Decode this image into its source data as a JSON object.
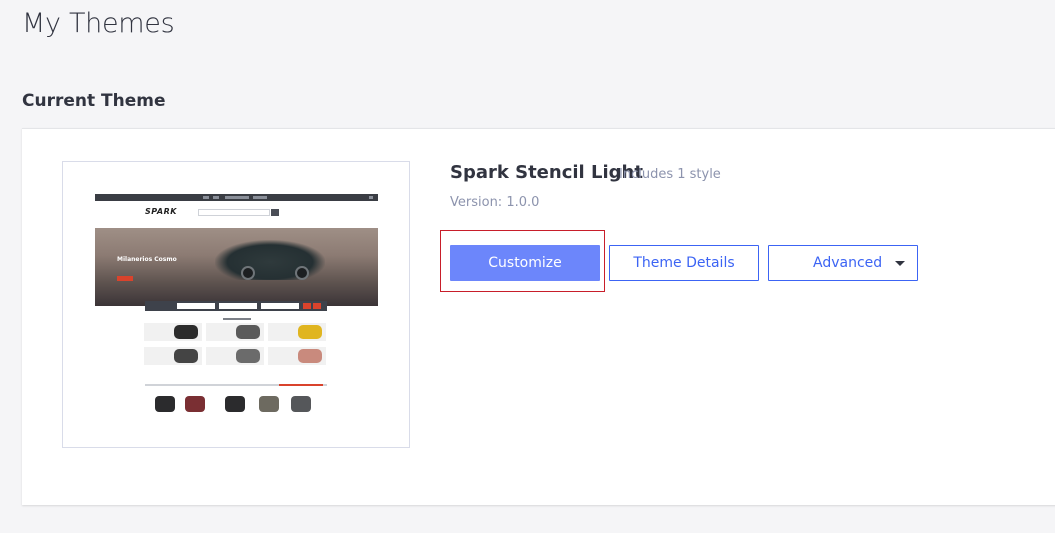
{
  "page": {
    "title": "My Themes"
  },
  "current_section": {
    "title": "Current Theme"
  },
  "theme": {
    "name": "Spark Stencil Light",
    "styles_note": "Includes 1 style",
    "version": "Version: 1.0.0",
    "preview": {
      "logo": "SPARK",
      "hero_text": "Milanerios Cosmo"
    }
  },
  "actions": {
    "customize_label": "Customize",
    "details_label": "Theme Details",
    "advanced_label": "Advanced"
  },
  "colors": {
    "primary": "#6c86fb",
    "link": "#3c64f4",
    "highlight_border": "#c81e2a",
    "background": "#f5f5f7"
  }
}
